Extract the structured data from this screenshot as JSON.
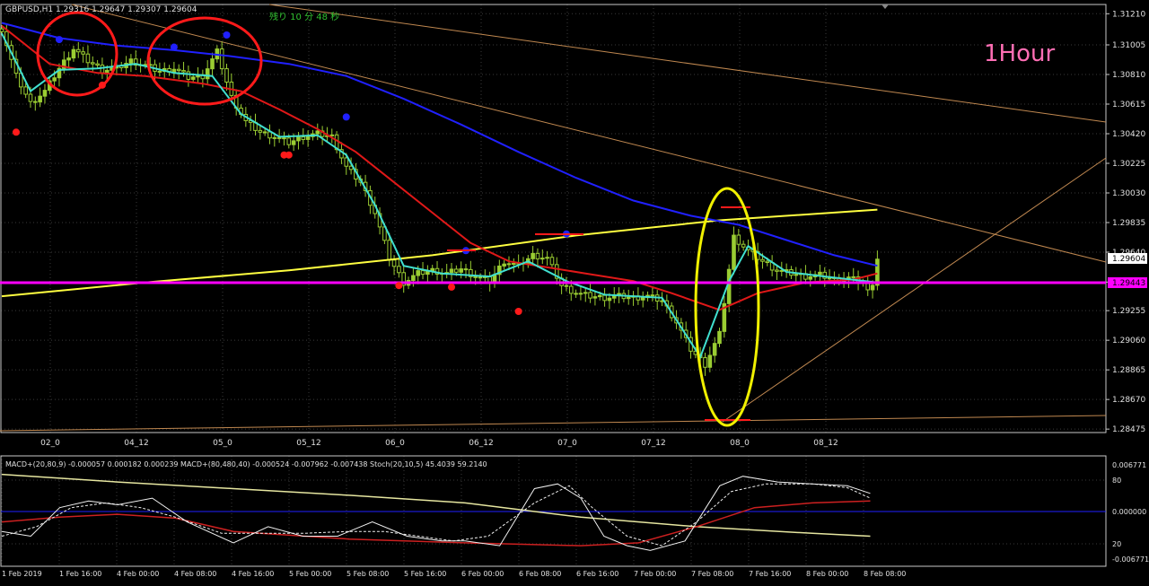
{
  "colors": {
    "background": "#000000",
    "grid": "#3a3a3a",
    "frame": "#c8c8c8",
    "candle": "#9acd32",
    "fast_ma": "#40e0d0",
    "mid_ma": "#e01818",
    "slow_ma": "#2020ff",
    "long_ma": "#ffff40",
    "support": "#ff00ff",
    "trend": "#c08850",
    "annotation_red": "#ff1a1a",
    "annotation_yellow": "#f0f000",
    "timeframe_label": "#ff6eb4",
    "timer": "#30c030",
    "macd_fast": "#f0f0f0",
    "macd_signal": "#cc2020",
    "macd_slow": "#e6e6a0",
    "macd_zero": "#2020ff"
  },
  "header": {
    "symbol_line": "GBPUSD,H1  1.29316 1.29647 1.29307 1.29604",
    "timer": "残り 10 分 48 秒",
    "timeframe": "1Hour"
  },
  "indicator_header": "MACD+(20,80,9) -0.000057 0.000182 0.000239  MACD+(80,480,40) -0.000524 -0.007962 -0.007438  Stoch(20,10,5) 45.4039 59.2140",
  "chart_data": [
    {
      "type": "line",
      "series_kind": "candlestick",
      "price_axis": {
        "ylim": [
          1.2847,
          1.312
        ],
        "ticks": [
          "1.31210",
          "1.31005",
          "1.30810",
          "1.30615",
          "1.30420",
          "1.30225",
          "1.30030",
          "1.29835",
          "1.29640",
          "1.29443",
          "1.29255",
          "1.29060",
          "1.28865",
          "1.28670",
          "1.28475"
        ]
      },
      "current_price": "1.29604",
      "support_level": "1.29443",
      "time_ticks": [
        "02_0",
        "04_12",
        "05_0",
        "05_12",
        "06_0",
        "06_12",
        "07_0",
        "07_12",
        "08_0",
        "08_12"
      ],
      "close_path": [
        [
          0,
          1.3111
        ],
        [
          3,
          1.308
        ],
        [
          6,
          1.3062
        ],
        [
          9,
          1.307
        ],
        [
          12,
          1.3085
        ],
        [
          15,
          1.3098
        ],
        [
          18,
          1.309
        ],
        [
          21,
          1.3084
        ],
        [
          24,
          1.3085
        ],
        [
          27,
          1.309
        ],
        [
          30,
          1.3087
        ],
        [
          33,
          1.3083
        ],
        [
          36,
          1.3085
        ],
        [
          39,
          1.3079
        ],
        [
          42,
          1.308
        ],
        [
          45,
          1.3096
        ],
        [
          48,
          1.3066
        ],
        [
          51,
          1.305
        ],
        [
          54,
          1.3043
        ],
        [
          57,
          1.304
        ],
        [
          60,
          1.3036
        ],
        [
          63,
          1.304
        ],
        [
          66,
          1.3042
        ],
        [
          69,
          1.304
        ],
        [
          72,
          1.302
        ],
        [
          75,
          1.301
        ],
        [
          78,
          1.299
        ],
        [
          81,
          1.296
        ],
        [
          84,
          1.2944
        ],
        [
          87,
          1.295
        ],
        [
          90,
          1.2952
        ],
        [
          93,
          1.295
        ],
        [
          96,
          1.2953
        ],
        [
          99,
          1.2948
        ],
        [
          102,
          1.2945
        ],
        [
          105,
          1.2958
        ],
        [
          108,
          1.2955
        ],
        [
          111,
          1.2962
        ],
        [
          114,
          1.296
        ],
        [
          117,
          1.2942
        ],
        [
          120,
          1.2937
        ],
        [
          123,
          1.2935
        ],
        [
          126,
          1.2934
        ],
        [
          129,
          1.2935
        ],
        [
          132,
          1.2934
        ],
        [
          135,
          1.2935
        ],
        [
          138,
          1.2932
        ],
        [
          141,
          1.2918
        ],
        [
          144,
          1.29
        ],
        [
          147,
          1.289
        ],
        [
          150,
          1.291
        ],
        [
          153,
          1.2974
        ],
        [
          156,
          1.2965
        ],
        [
          159,
          1.2958
        ],
        [
          162,
          1.2952
        ],
        [
          165,
          1.295
        ],
        [
          168,
          1.2948
        ],
        [
          171,
          1.2949
        ],
        [
          174,
          1.2946
        ],
        [
          177,
          1.2947
        ],
        [
          180,
          1.2944
        ],
        [
          181,
          1.2938
        ],
        [
          182,
          1.2944
        ],
        [
          183,
          1.296
        ]
      ],
      "ma_fast": [
        [
          0,
          1.3108
        ],
        [
          6,
          1.307
        ],
        [
          12,
          1.3084
        ],
        [
          20,
          1.3085
        ],
        [
          28,
          1.3088
        ],
        [
          36,
          1.3082
        ],
        [
          44,
          1.308
        ],
        [
          50,
          1.3055
        ],
        [
          58,
          1.304
        ],
        [
          66,
          1.3041
        ],
        [
          72,
          1.3028
        ],
        [
          78,
          1.2995
        ],
        [
          84,
          1.2955
        ],
        [
          92,
          1.295
        ],
        [
          102,
          1.2948
        ],
        [
          110,
          1.2958
        ],
        [
          118,
          1.2945
        ],
        [
          126,
          1.2936
        ],
        [
          138,
          1.2934
        ],
        [
          146,
          1.2895
        ],
        [
          152,
          1.2945
        ],
        [
          156,
          1.2968
        ],
        [
          164,
          1.2951
        ],
        [
          172,
          1.2948
        ],
        [
          183,
          1.2944
        ]
      ],
      "ma_mid": [
        [
          0,
          1.3113
        ],
        [
          10,
          1.3088
        ],
        [
          20,
          1.3082
        ],
        [
          30,
          1.308
        ],
        [
          42,
          1.3075
        ],
        [
          50,
          1.307
        ],
        [
          58,
          1.3058
        ],
        [
          66,
          1.3045
        ],
        [
          74,
          1.303
        ],
        [
          82,
          1.301
        ],
        [
          90,
          1.299
        ],
        [
          98,
          1.297
        ],
        [
          106,
          1.2958
        ],
        [
          114,
          1.2954
        ],
        [
          122,
          1.295
        ],
        [
          132,
          1.2945
        ],
        [
          140,
          1.2937
        ],
        [
          150,
          1.2926
        ],
        [
          158,
          1.2937
        ],
        [
          168,
          1.2944
        ],
        [
          178,
          1.2946
        ],
        [
          183,
          1.295
        ]
      ],
      "ma_slow": [
        [
          0,
          1.3115
        ],
        [
          12,
          1.3105
        ],
        [
          24,
          1.31
        ],
        [
          36,
          1.3097
        ],
        [
          48,
          1.3093
        ],
        [
          60,
          1.3088
        ],
        [
          72,
          1.308
        ],
        [
          84,
          1.3065
        ],
        [
          96,
          1.3048
        ],
        [
          108,
          1.303
        ],
        [
          120,
          1.3013
        ],
        [
          132,
          1.2998
        ],
        [
          144,
          1.2988
        ],
        [
          154,
          1.2982
        ],
        [
          164,
          1.2972
        ],
        [
          174,
          1.2962
        ],
        [
          183,
          1.2955
        ]
      ],
      "ma_long": [
        [
          0,
          1.2935
        ],
        [
          30,
          1.2944
        ],
        [
          60,
          1.2952
        ],
        [
          90,
          1.2962
        ],
        [
          120,
          1.2975
        ],
        [
          150,
          1.2985
        ],
        [
          183,
          1.2992
        ]
      ],
      "signals_up": [
        [
          3,
          1.3043
        ],
        [
          21,
          1.3074
        ],
        [
          59,
          1.3028
        ],
        [
          60,
          1.3028
        ],
        [
          83,
          1.2942
        ],
        [
          94,
          1.2941
        ],
        [
          108,
          1.2925
        ]
      ],
      "signals_down": [
        [
          12,
          1.3104
        ],
        [
          36,
          1.3099
        ],
        [
          47,
          1.3107
        ],
        [
          72,
          1.3053
        ],
        [
          97,
          1.2965
        ],
        [
          118,
          1.2976
        ]
      ]
    },
    {
      "type": "line",
      "series_kind": "macd-stochastic",
      "ylim": [
        -0.006771,
        0.006771
      ],
      "ticks": [
        "0.006771",
        "80",
        "0.000000",
        "20",
        "-0.006771"
      ],
      "time_ticks": [
        "1 Feb 2019",
        "1 Feb 16:00",
        "4 Feb 00:00",
        "4 Feb 08:00",
        "4 Feb 16:00",
        "5 Feb 00:00",
        "5 Feb 08:00",
        "5 Feb 16:00",
        "6 Feb 00:00",
        "6 Feb 08:00",
        "6 Feb 16:00",
        "7 Feb 00:00",
        "7 Feb 08:00",
        "7 Feb 16:00",
        "8 Feb 00:00",
        "8 Feb 08:00"
      ],
      "stoch_main": [
        [
          0,
          30
        ],
        [
          5,
          25
        ],
        [
          10,
          55
        ],
        [
          15,
          62
        ],
        [
          20,
          58
        ],
        [
          26,
          65
        ],
        [
          32,
          40
        ],
        [
          40,
          18
        ],
        [
          46,
          35
        ],
        [
          52,
          25
        ],
        [
          58,
          25
        ],
        [
          64,
          40
        ],
        [
          70,
          25
        ],
        [
          76,
          20
        ],
        [
          80,
          20
        ],
        [
          86,
          15
        ],
        [
          92,
          75
        ],
        [
          96,
          80
        ],
        [
          100,
          65
        ],
        [
          104,
          25
        ],
        [
          108,
          15
        ],
        [
          112,
          10
        ],
        [
          118,
          20
        ],
        [
          124,
          78
        ],
        [
          128,
          88
        ],
        [
          134,
          82
        ],
        [
          140,
          80
        ],
        [
          146,
          78
        ],
        [
          150,
          70
        ]
      ],
      "stoch_signal": [
        [
          0,
          25
        ],
        [
          6,
          35
        ],
        [
          12,
          55
        ],
        [
          18,
          60
        ],
        [
          24,
          55
        ],
        [
          30,
          45
        ],
        [
          38,
          28
        ],
        [
          44,
          28
        ],
        [
          52,
          28
        ],
        [
          60,
          30
        ],
        [
          66,
          30
        ],
        [
          72,
          25
        ],
        [
          78,
          20
        ],
        [
          84,
          25
        ],
        [
          92,
          60
        ],
        [
          98,
          78
        ],
        [
          102,
          55
        ],
        [
          108,
          25
        ],
        [
          114,
          15
        ],
        [
          120,
          40
        ],
        [
          126,
          72
        ],
        [
          132,
          80
        ],
        [
          140,
          80
        ],
        [
          146,
          76
        ],
        [
          150,
          65
        ]
      ],
      "macd_slow": [
        [
          0,
          90
        ],
        [
          20,
          82
        ],
        [
          40,
          75
        ],
        [
          60,
          68
        ],
        [
          80,
          60
        ],
        [
          100,
          45
        ],
        [
          120,
          35
        ],
        [
          140,
          28
        ],
        [
          150,
          25
        ]
      ],
      "macd_signal": [
        [
          0,
          40
        ],
        [
          10,
          45
        ],
        [
          20,
          48
        ],
        [
          30,
          44
        ],
        [
          40,
          30
        ],
        [
          60,
          22
        ],
        [
          80,
          18
        ],
        [
          100,
          15
        ],
        [
          110,
          18
        ],
        [
          120,
          35
        ],
        [
          130,
          55
        ],
        [
          140,
          60
        ],
        [
          150,
          62
        ]
      ]
    }
  ]
}
